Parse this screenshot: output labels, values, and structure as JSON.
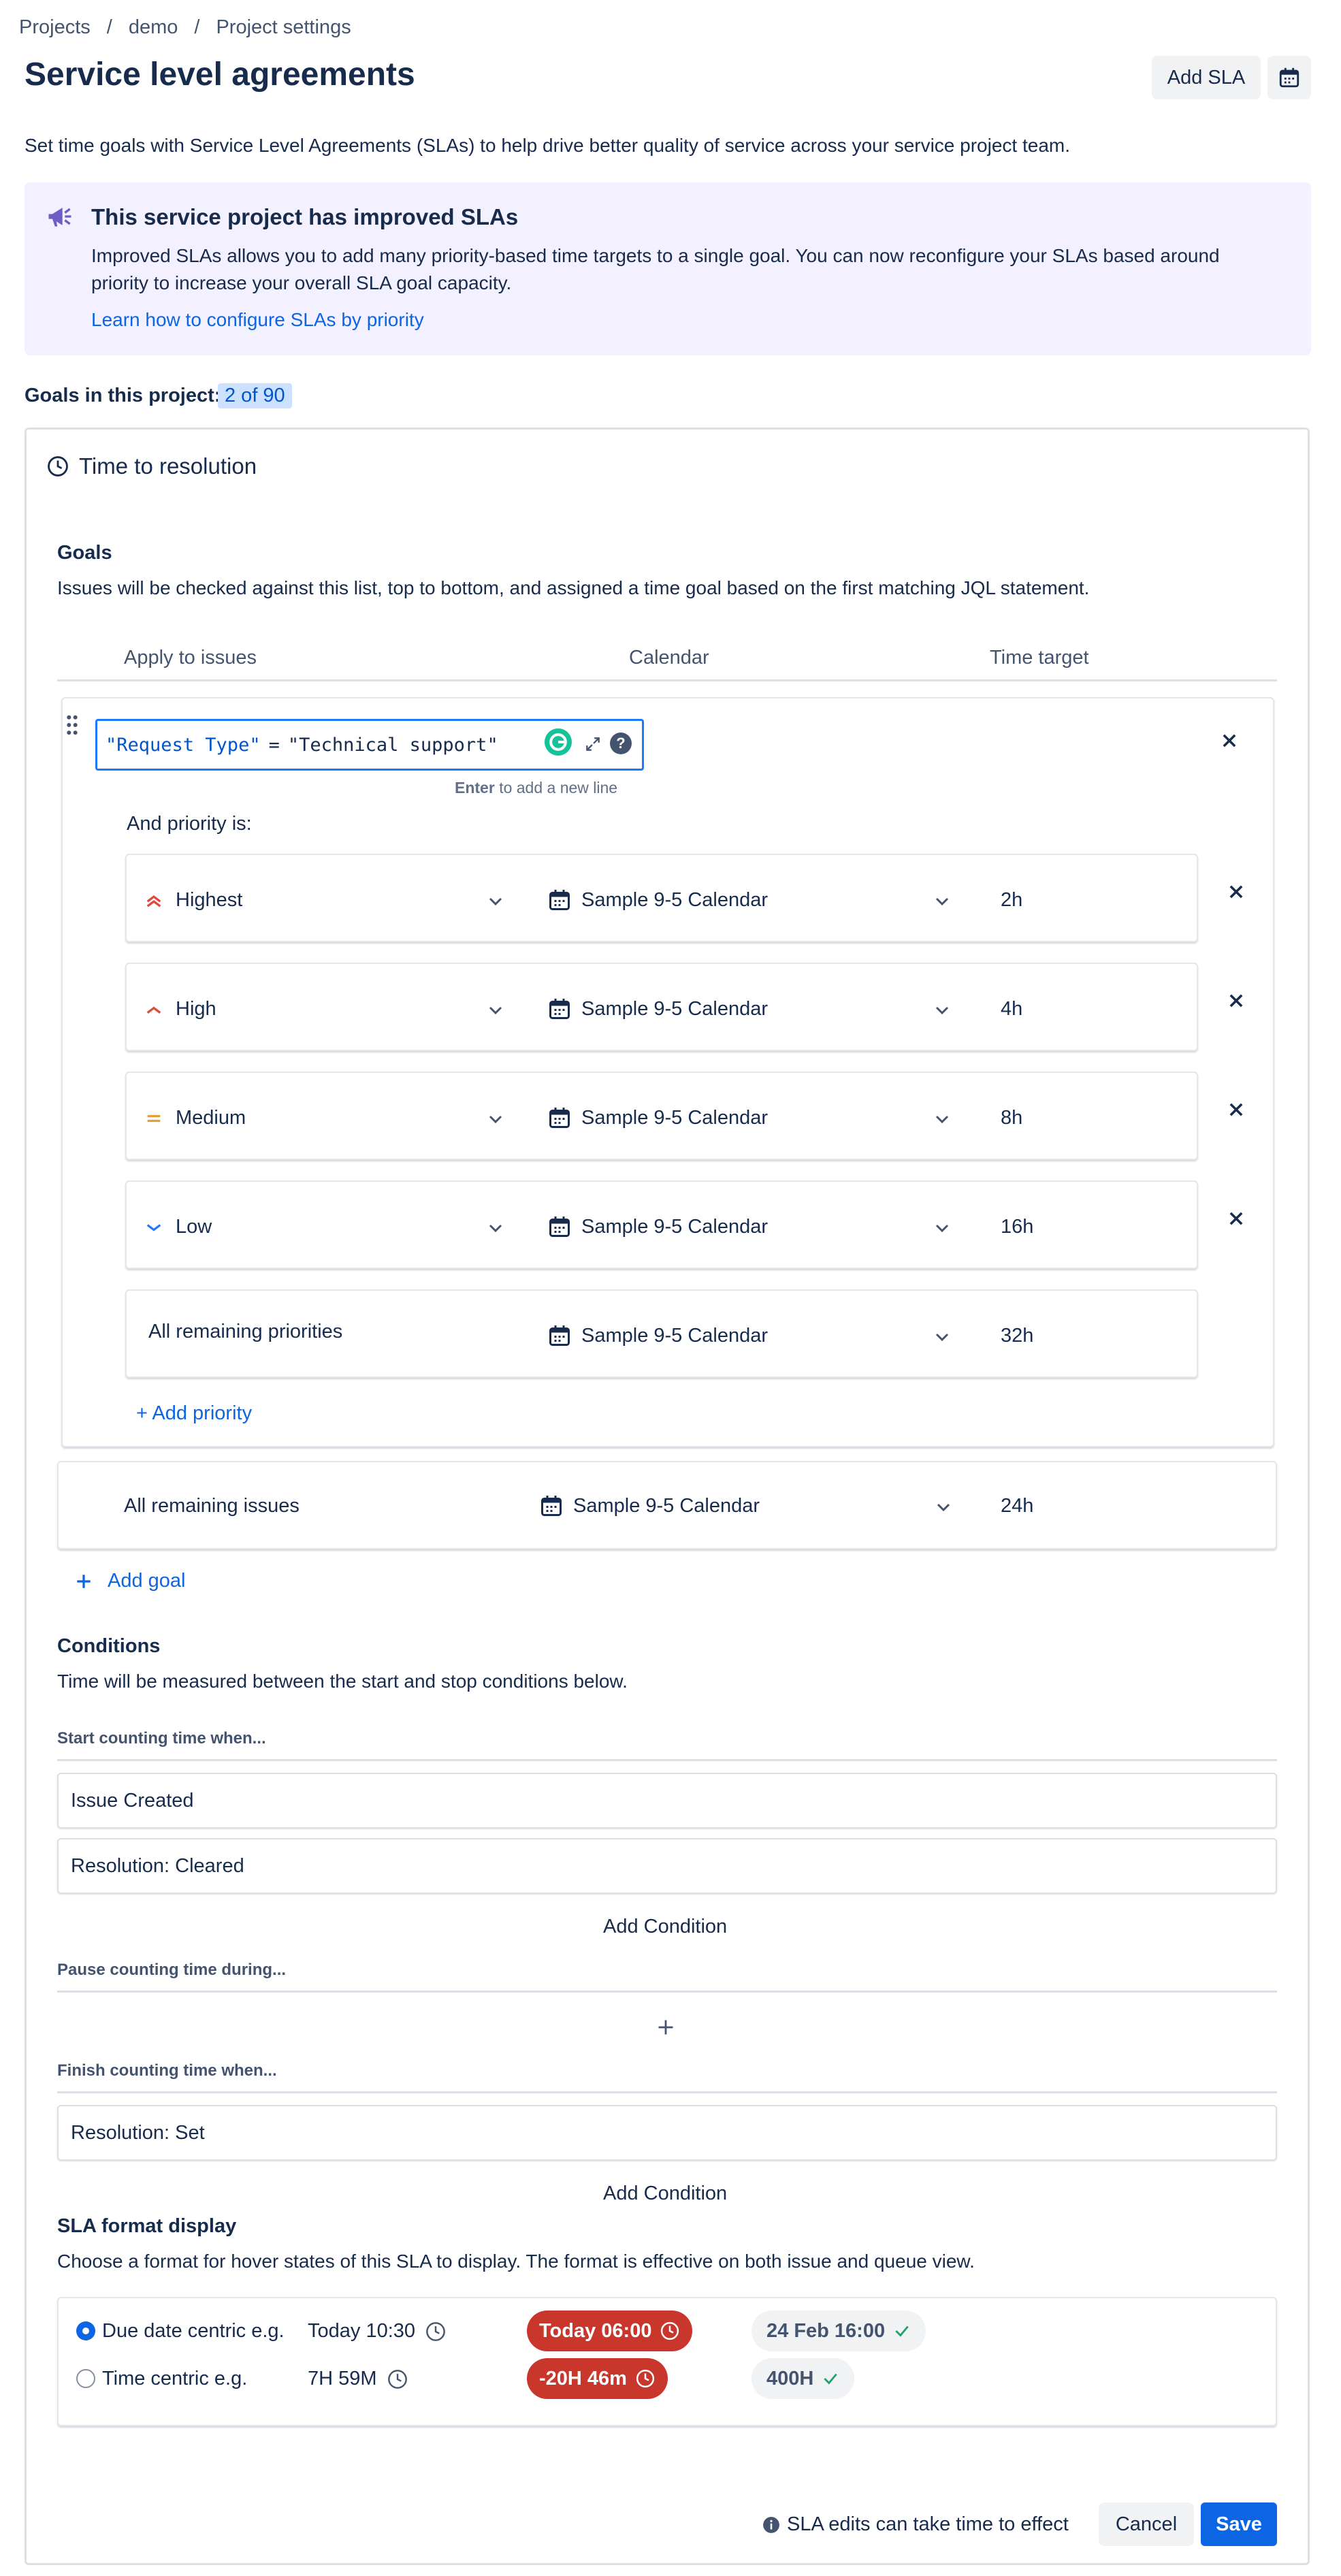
{
  "breadcrumb": {
    "items": [
      "Projects",
      "demo",
      "Project settings"
    ],
    "separator": "/"
  },
  "header": {
    "title": "Service level agreements",
    "add_sla_label": "Add SLA"
  },
  "intro_text": "Set time goals with Service Level Agreements (SLAs) to help drive better quality of service across your service project team.",
  "banner": {
    "title": "This service project has improved SLAs",
    "body": "Improved SLAs allows you to add many priority-based time targets to a single goal. You can now reconfigure your SLAs based around priority to increase your overall SLA goal capacity.",
    "link": "Learn how to configure SLAs by priority"
  },
  "goals_count": {
    "label": "Goals in this project:",
    "value": "2 of 90"
  },
  "sla": {
    "title": "Time to resolution",
    "goals": {
      "heading": "Goals",
      "description": "Issues will be checked against this list, top to bottom, and assigned a time goal based on the first matching JQL statement.",
      "columns": [
        "Apply to issues",
        "Calendar",
        "Time target"
      ],
      "jql": {
        "field": "\"Request Type\"",
        "op": "=",
        "value": "\"Technical support\""
      },
      "jql_hint_key": "Enter",
      "jql_hint_rest": "to add a new line",
      "priority_label": "And priority is:",
      "priorities": [
        {
          "name": "Highest",
          "calendar": "Sample 9-5 Calendar",
          "target": "2h",
          "icon": "priority-highest-icon"
        },
        {
          "name": "High",
          "calendar": "Sample 9-5 Calendar",
          "target": "4h",
          "icon": "priority-high-icon"
        },
        {
          "name": "Medium",
          "calendar": "Sample 9-5 Calendar",
          "target": "8h",
          "icon": "priority-medium-icon"
        },
        {
          "name": "Low",
          "calendar": "Sample 9-5 Calendar",
          "target": "16h",
          "icon": "priority-low-icon"
        }
      ],
      "remaining_priorities": {
        "name": "All remaining priorities",
        "calendar": "Sample 9-5 Calendar",
        "target": "32h"
      },
      "add_priority": "+ Add priority",
      "remaining_issues": {
        "name": "All remaining issues",
        "calendar": "Sample 9-5 Calendar",
        "target": "24h"
      },
      "add_goal": "Add goal"
    },
    "conditions": {
      "heading": "Conditions",
      "description": "Time will be measured between the start and stop conditions below.",
      "start_label": "Start counting time when...",
      "start_items": [
        "Issue Created",
        "Resolution: Cleared"
      ],
      "add_condition": "Add Condition",
      "pause_label": "Pause counting time during...",
      "finish_label": "Finish counting time when...",
      "finish_items": [
        "Resolution: Set"
      ]
    },
    "format": {
      "heading": "SLA format display",
      "description": "Choose a format for hover states of this SLA to display. The format is effective on both issue and queue view.",
      "options": [
        {
          "label": "Due date centric e.g.",
          "example": "Today 10:30",
          "breached": "Today 06:00",
          "met": "24 Feb 16:00",
          "selected": true
        },
        {
          "label": "Time centric e.g.",
          "example": "7H 59M",
          "breached": "-20H 46m",
          "met": "400H",
          "selected": false
        }
      ]
    },
    "footer": {
      "note": "SLA edits can take time to effect",
      "cancel": "Cancel",
      "save": "Save"
    }
  },
  "colors": {
    "primary": "#0c66e4",
    "danger": "#c9372c",
    "banner_bg": "#f3f0ff",
    "success": "#22a06b"
  }
}
